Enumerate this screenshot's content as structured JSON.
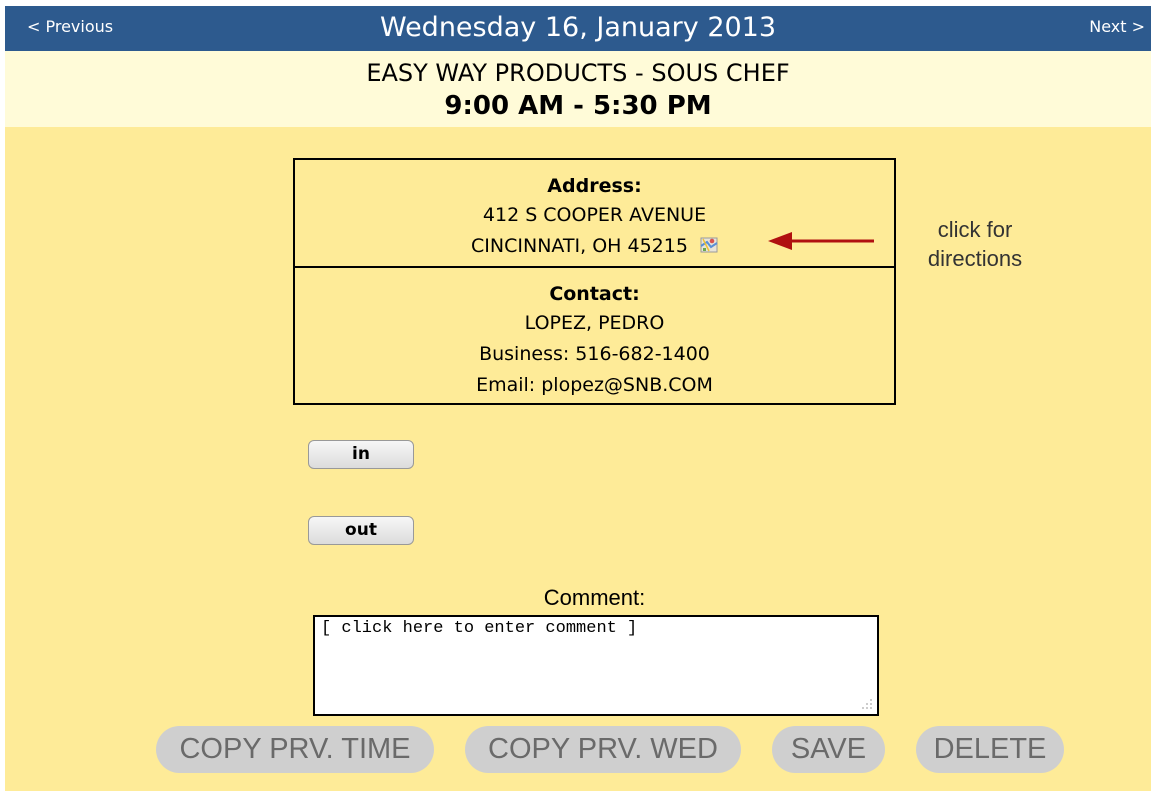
{
  "nav": {
    "previous_label": "< Previous",
    "next_label": "Next >",
    "date": "Wednesday 16, January 2013"
  },
  "header": {
    "job_title": "EASY WAY PRODUCTS - SOUS CHEF",
    "hours": "9:00 AM - 5:30 PM"
  },
  "address": {
    "title": "Address:",
    "street": "412 S COOPER AVENUE",
    "city_line": "CINCINNATI, OH 45215",
    "map_icon": "map-icon"
  },
  "directions_hint": {
    "line1": "click for",
    "line2": "directions"
  },
  "contact": {
    "title": "Contact:",
    "name": "LOPEZ, PEDRO",
    "business": "Business: 516-682-1400",
    "email": "Email: plopez@SNB.COM"
  },
  "punch": {
    "in_label": "in",
    "out_label": "out"
  },
  "comment": {
    "label": "Comment:",
    "value": "[ click here to enter comment ]"
  },
  "actions": {
    "copy_prev_time": "COPY PRV. TIME",
    "copy_prev_day": "COPY PRV. WED",
    "save": "SAVE",
    "delete": "DELETE"
  },
  "colors": {
    "nav_bar": "#2d5a8e",
    "header_bg": "#fffbd8",
    "main_bg": "#feeb98",
    "arrow": "#b01010",
    "action_button": "#cfcfcf"
  }
}
